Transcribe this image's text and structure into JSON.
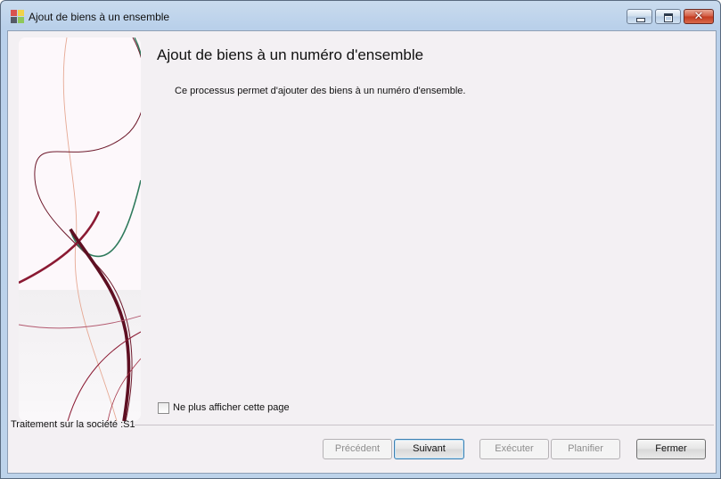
{
  "window": {
    "title": "Ajout de biens à un ensemble",
    "controls": {
      "minimize_icon": "minimize-icon",
      "maximize_icon": "maximize-icon",
      "close_icon": "close-icon",
      "close_glyph": "✕"
    }
  },
  "wizard": {
    "heading": "Ajout de biens à un numéro d'ensemble",
    "description": "Ce processus permet d'ajouter des biens à un numéro d'ensemble.",
    "dont_show_again": {
      "label": "Ne plus afficher cette page",
      "checked": false
    }
  },
  "status": {
    "company_label": "Traitement sur la société :S1"
  },
  "buttons": {
    "previous": {
      "label": "Précédent",
      "enabled": false
    },
    "next": {
      "label": "Suivant",
      "enabled": true
    },
    "execute": {
      "label": "Exécuter",
      "enabled": false
    },
    "schedule": {
      "label": "Planifier",
      "enabled": false
    },
    "close": {
      "label": "Fermer",
      "enabled": true
    }
  },
  "colors": {
    "accent_maroon": "#7a1530",
    "accent_green": "#2f7a5c",
    "panel_background": "#f3f0f3"
  }
}
